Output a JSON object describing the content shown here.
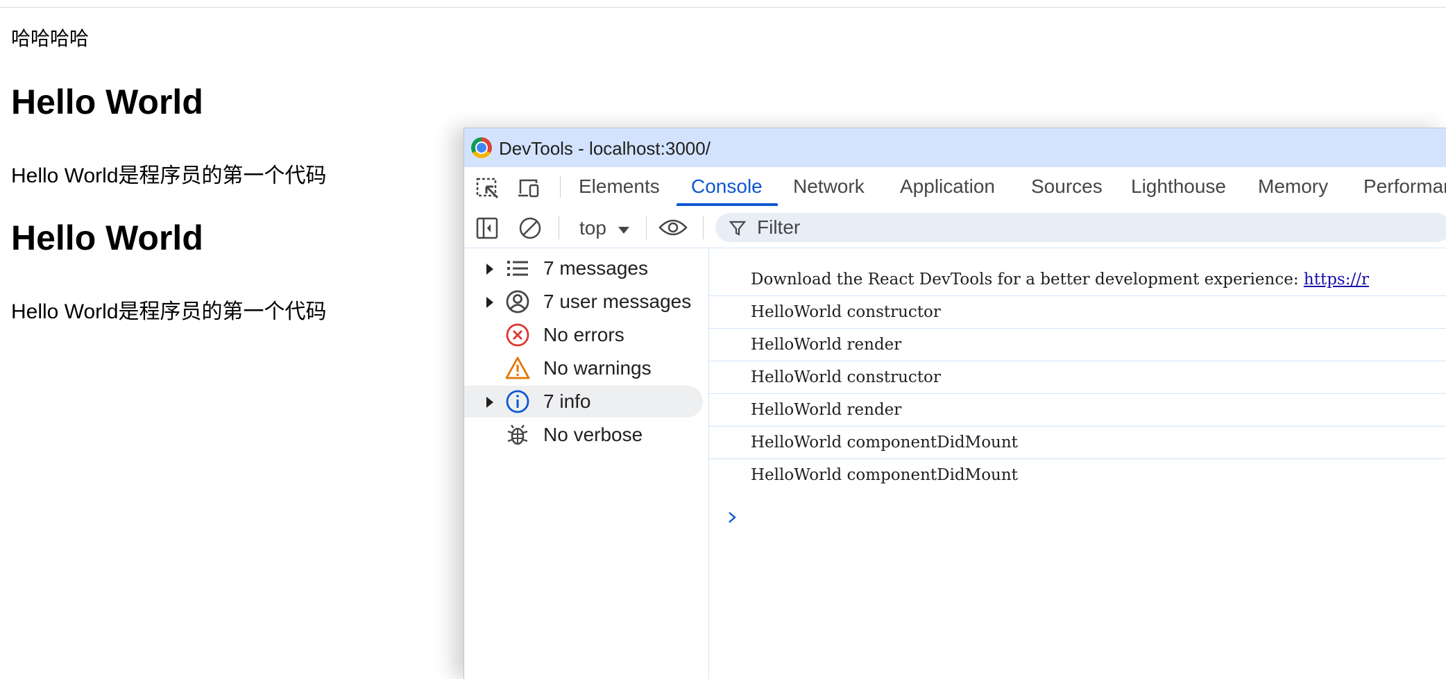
{
  "page": {
    "line1": "哈哈哈哈",
    "heading1": "Hello World",
    "para1": "Hello World是程序员的第一个代码",
    "heading2": "Hello World",
    "para2": "Hello World是程序员的第一个代码"
  },
  "devtools": {
    "title": "DevTools - localhost:3000/",
    "tabs": [
      "Elements",
      "Console",
      "Network",
      "Application",
      "Sources",
      "Lighthouse",
      "Memory",
      "Performan"
    ],
    "active_tab": "Console",
    "toolbar": {
      "context": "top",
      "filter_placeholder": "Filter"
    },
    "sidebar": [
      {
        "label": "7 messages",
        "icon": "list-icon",
        "expandable": true
      },
      {
        "label": "7 user messages",
        "icon": "user-icon",
        "expandable": true
      },
      {
        "label": "No errors",
        "icon": "error-icon",
        "expandable": false
      },
      {
        "label": "No warnings",
        "icon": "warning-icon",
        "expandable": false
      },
      {
        "label": "7 info",
        "icon": "info-icon",
        "expandable": true,
        "selected": true
      },
      {
        "label": "No verbose",
        "icon": "bug-icon",
        "expandable": false
      }
    ],
    "console": {
      "first_message_text": "Download the React DevTools for a better development experience: ",
      "first_message_link": "https://r",
      "messages": [
        "HelloWorld constructor",
        "HelloWorld render",
        "HelloWorld constructor",
        "HelloWorld render",
        "HelloWorld componentDidMount",
        "HelloWorld componentDidMount"
      ]
    }
  },
  "colors": {
    "titlebar_bg": "#d3e3fd",
    "accent": "#0b57d0",
    "error": "#dc362e",
    "warning": "#e37400",
    "link": "#1a0dab"
  }
}
